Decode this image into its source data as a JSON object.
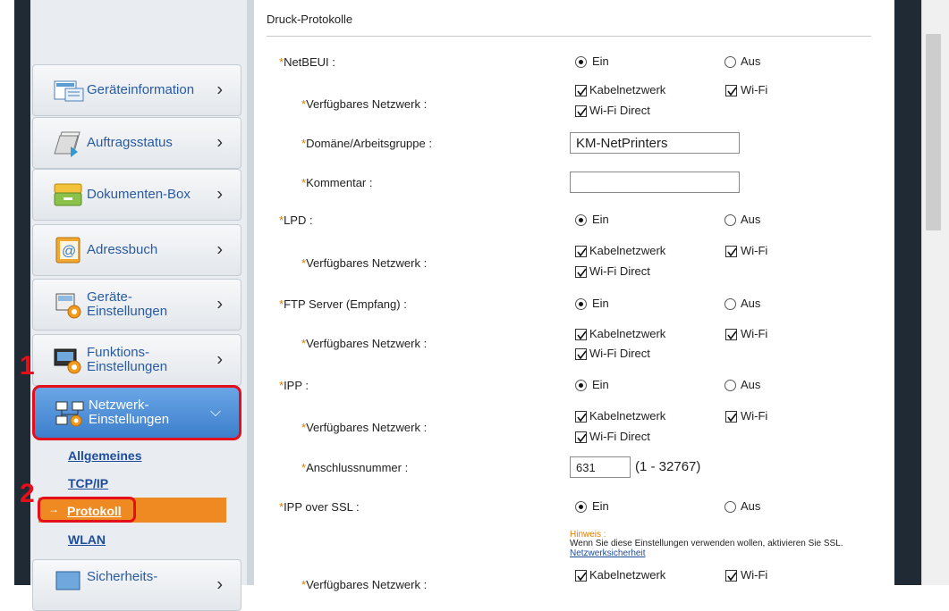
{
  "sidebar": {
    "items": [
      {
        "label": "Geräteinformation",
        "icon": "device-info-icon"
      },
      {
        "label": "Auftragsstatus",
        "icon": "job-status-icon"
      },
      {
        "label": "Dokumenten-Box",
        "icon": "document-box-icon"
      },
      {
        "label": "Adressbuch",
        "icon": "address-book-icon"
      },
      {
        "label_line1": "Geräte-",
        "label_line2": "Einstellungen",
        "icon": "device-settings-icon"
      },
      {
        "label_line1": "Funktions-",
        "label_line2": "Einstellungen",
        "icon": "function-settings-icon"
      },
      {
        "label_line1": "Netzwerk-",
        "label_line2": "Einstellungen",
        "icon": "network-settings-icon"
      },
      {
        "label": "Sicherheits-",
        "icon": "security-settings-icon"
      }
    ],
    "sub_items": [
      "Allgemeines",
      "TCP/IP",
      "Protokoll",
      "WLAN"
    ],
    "step_markers": [
      "1",
      "2"
    ]
  },
  "main": {
    "section_title": "Druck-Protokolle",
    "required_mark": "*",
    "on_label": "Ein",
    "off_label": "Aus",
    "net_wired": "Kabelnetzwerk",
    "net_wifi": "Wi-Fi",
    "net_direct": "Wi-Fi Direct",
    "rows": {
      "netbeui": "NetBEUI :",
      "avail_network": "Verfügbares Netzwerk :",
      "domain": "Domäne/Arbeitsgruppe :",
      "comment": "Kommentar :",
      "lpd": "LPD :",
      "ftp": "FTP Server (Empfang) :",
      "ipp": "IPP :",
      "port_number": "Anschlussnummer :",
      "ipp_ssl": "IPP over SSL :"
    },
    "domain_value": "KM-NetPrinters",
    "comment_value": "",
    "port_value": "631",
    "port_range": "(1 - 32767)",
    "hint_title": "Hinweis :",
    "hint_text": "Wenn Sie diese Einstellungen verwenden wollen, aktivieren Sie SSL.",
    "hint_link": "Netzwerksicherheit"
  },
  "colors": {
    "accent_red": "#e3101b",
    "active_blue": "#3d7fcc",
    "active_sub_orange": "#ef8a22",
    "required_orange": "#e07b00",
    "link_blue": "#1d4d9a"
  }
}
